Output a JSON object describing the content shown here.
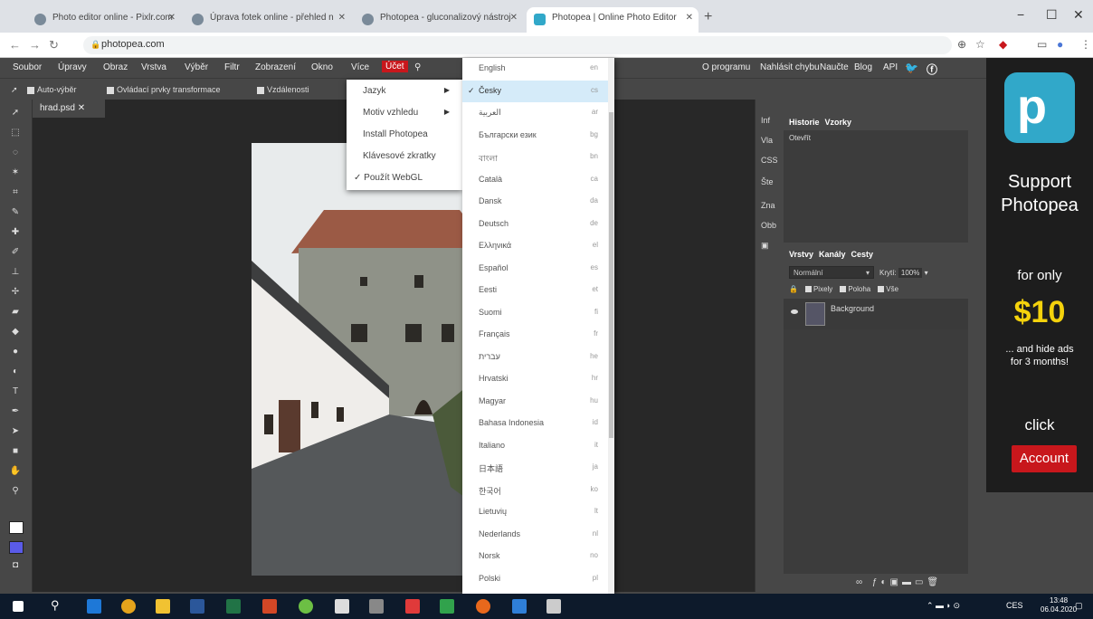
{
  "browser": {
    "tabs": [
      {
        "title": "Photo editor online - Pixlr.com"
      },
      {
        "title": "Úprava fotek online - přehled n"
      },
      {
        "title": "Photopea - gluconalizový nástroj"
      },
      {
        "title": "Photopea | Online Photo Editor"
      }
    ],
    "url": "photopea.com",
    "win_min": "−",
    "win_max": "☐",
    "win_close": "✕"
  },
  "menubar": {
    "items": [
      "Soubor",
      "Úpravy",
      "Obraz",
      "Vrstva",
      "Výběr",
      "Filtr",
      "Zobrazení",
      "Okno",
      "Více",
      "Účet"
    ],
    "right_links": [
      "O programu",
      "Nahlásit chybu",
      "Naučte",
      "Blog",
      "API"
    ]
  },
  "options": {
    "auto_select": "Auto-výběr",
    "transform": "Ovládací prvky transformace",
    "distances": "Vzdálenosti"
  },
  "document": {
    "tab_title": "hrad.psd",
    "close": "✕"
  },
  "midpanel": [
    "Inf",
    "Vla",
    "CSS",
    "Šte",
    "Zna",
    "Obb"
  ],
  "history_panel": {
    "tabs": [
      "Historie",
      "Vzorky"
    ],
    "first_item": "Otevřít"
  },
  "layers_panel": {
    "tabs": [
      "Vrstvy",
      "Kanály",
      "Cesty"
    ],
    "blend_mode": "Normální",
    "opacity_label": "Krytí:",
    "opacity_value": "100%",
    "locks": [
      "Pixely",
      "Poloha",
      "Vše"
    ],
    "layer_name": "Background"
  },
  "account_menu": {
    "items": [
      {
        "label": "Jazyk",
        "has_submenu": true
      },
      {
        "label": "Motiv vzhledu",
        "has_submenu": true
      },
      {
        "label": "Install Photopea",
        "has_submenu": false
      },
      {
        "label": "Klávesové zkratky",
        "has_submenu": false
      },
      {
        "label": "✓ Použít WebGL",
        "has_submenu": false
      }
    ]
  },
  "languages": [
    {
      "name": "English",
      "code": "en"
    },
    {
      "name": "Česky",
      "code": "cs",
      "checked": true
    },
    {
      "name": "العربية",
      "code": "ar"
    },
    {
      "name": "Български език",
      "code": "bg"
    },
    {
      "name": "বাংলা",
      "code": "bn"
    },
    {
      "name": "Català",
      "code": "ca"
    },
    {
      "name": "Dansk",
      "code": "da"
    },
    {
      "name": "Deutsch",
      "code": "de"
    },
    {
      "name": "Ελληνικά",
      "code": "el"
    },
    {
      "name": "Español",
      "code": "es"
    },
    {
      "name": "Eesti",
      "code": "et"
    },
    {
      "name": "Suomi",
      "code": "fi"
    },
    {
      "name": "Français",
      "code": "fr"
    },
    {
      "name": "עברית",
      "code": "he"
    },
    {
      "name": "Hrvatski",
      "code": "hr"
    },
    {
      "name": "Magyar",
      "code": "hu"
    },
    {
      "name": "Bahasa Indonesia",
      "code": "id"
    },
    {
      "name": "Italiano",
      "code": "it"
    },
    {
      "name": "日本語",
      "code": "ja"
    },
    {
      "name": "한국어",
      "code": "ko"
    },
    {
      "name": "Lietuvių",
      "code": "lt"
    },
    {
      "name": "Nederlands",
      "code": "nl"
    },
    {
      "name": "Norsk",
      "code": "no"
    },
    {
      "name": "Polski",
      "code": "pl"
    }
  ],
  "ad": {
    "line1": "Support",
    "line2": "Photopea",
    "line3": "for only",
    "price": "$10",
    "line4": "... and hide ads",
    "line5": "for 3 months!",
    "line6": "click",
    "button": "Account"
  },
  "taskbar": {
    "lang": "CES",
    "time": "13:48",
    "date": "06.04.2020"
  },
  "colors": {
    "accent_red": "#c8171c",
    "photopea_teal": "#31a8c9",
    "panel_bg": "#474747",
    "canvas_bg": "#282828"
  }
}
